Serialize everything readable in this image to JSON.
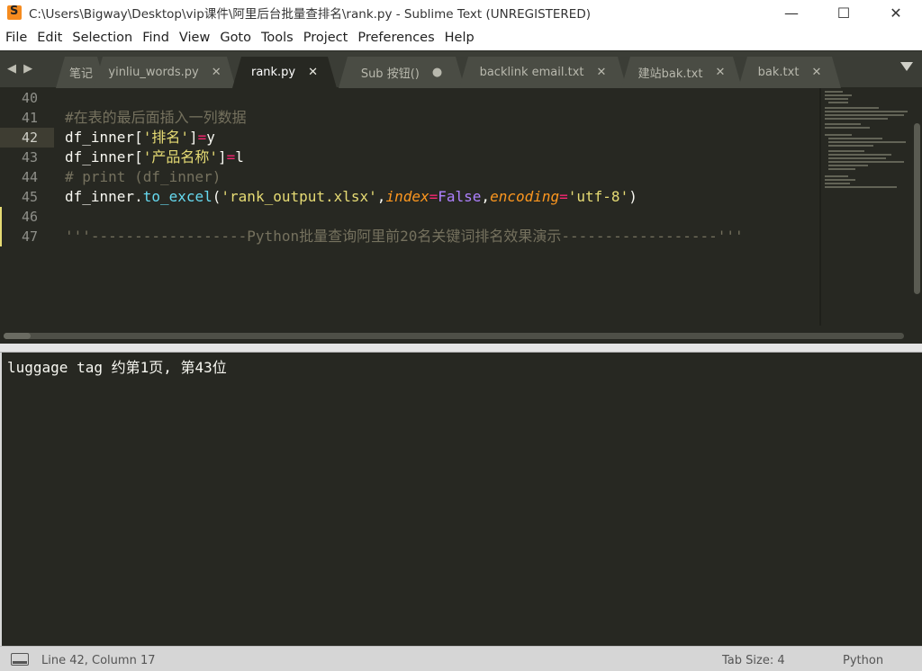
{
  "window": {
    "title": "C:\\Users\\Bigway\\Desktop\\vip课件\\阿里后台批量查排名\\rank.py - Sublime Text (UNREGISTERED)",
    "minimize": "—",
    "maximize": "☐",
    "close": "✕"
  },
  "menu": [
    "File",
    "Edit",
    "Selection",
    "Find",
    "View",
    "Goto",
    "Tools",
    "Project",
    "Preferences",
    "Help"
  ],
  "tabs": [
    {
      "label": "笔记",
      "close": ""
    },
    {
      "label": "yinliu_words.py",
      "close": "✕"
    },
    {
      "label": "rank.py",
      "close": "✕",
      "active": true
    },
    {
      "label": "Sub 按钮()",
      "close": "●"
    },
    {
      "label": "backlink email.txt",
      "close": "✕"
    },
    {
      "label": "建站bak.txt",
      "close": "✕"
    },
    {
      "label": "bak.txt",
      "close": "✕"
    }
  ],
  "tab_nav": "◀ ▶",
  "editor": {
    "line_numbers": [
      "40",
      "41",
      "42",
      "43",
      "44",
      "45",
      "46",
      "47"
    ],
    "current_line": "42",
    "code": {
      "l41": "#在表的最后面插入一列数据",
      "l42_a": "df_inner[",
      "l42_b": "'排名'",
      "l42_c": "]",
      "l42_d": "=",
      "l42_e": "y",
      "l43_a": "df_inner[",
      "l43_b": "'产品名称'",
      "l43_c": "]",
      "l43_d": "=",
      "l43_e": "l",
      "l44": "# print (df_inner)",
      "l45_a": "df_inner.",
      "l45_b": "to_excel",
      "l45_c": "(",
      "l45_d": "'rank_output.xlsx'",
      "l45_e": ",",
      "l45_f": "index",
      "l45_g": "=",
      "l45_h": "False",
      "l45_i": ",",
      "l45_j": "encoding",
      "l45_k": "=",
      "l45_l": "'utf-8'",
      "l45_m": ")",
      "l47": "'''------------------Python批量查询阿里前20名关键词排名效果演示------------------'''"
    }
  },
  "output": {
    "text": "luggage tag 约第1页, 第43位"
  },
  "status": {
    "position": "Line 42, Column 17",
    "tab_size": "Tab Size: 4",
    "syntax": "Python"
  },
  "colors": {
    "background": "#272822",
    "comment": "#75715e",
    "string": "#e6db74",
    "operator": "#f92672",
    "function": "#66d9ef",
    "keyword_arg": "#fd971f",
    "constant": "#ae81ff"
  }
}
